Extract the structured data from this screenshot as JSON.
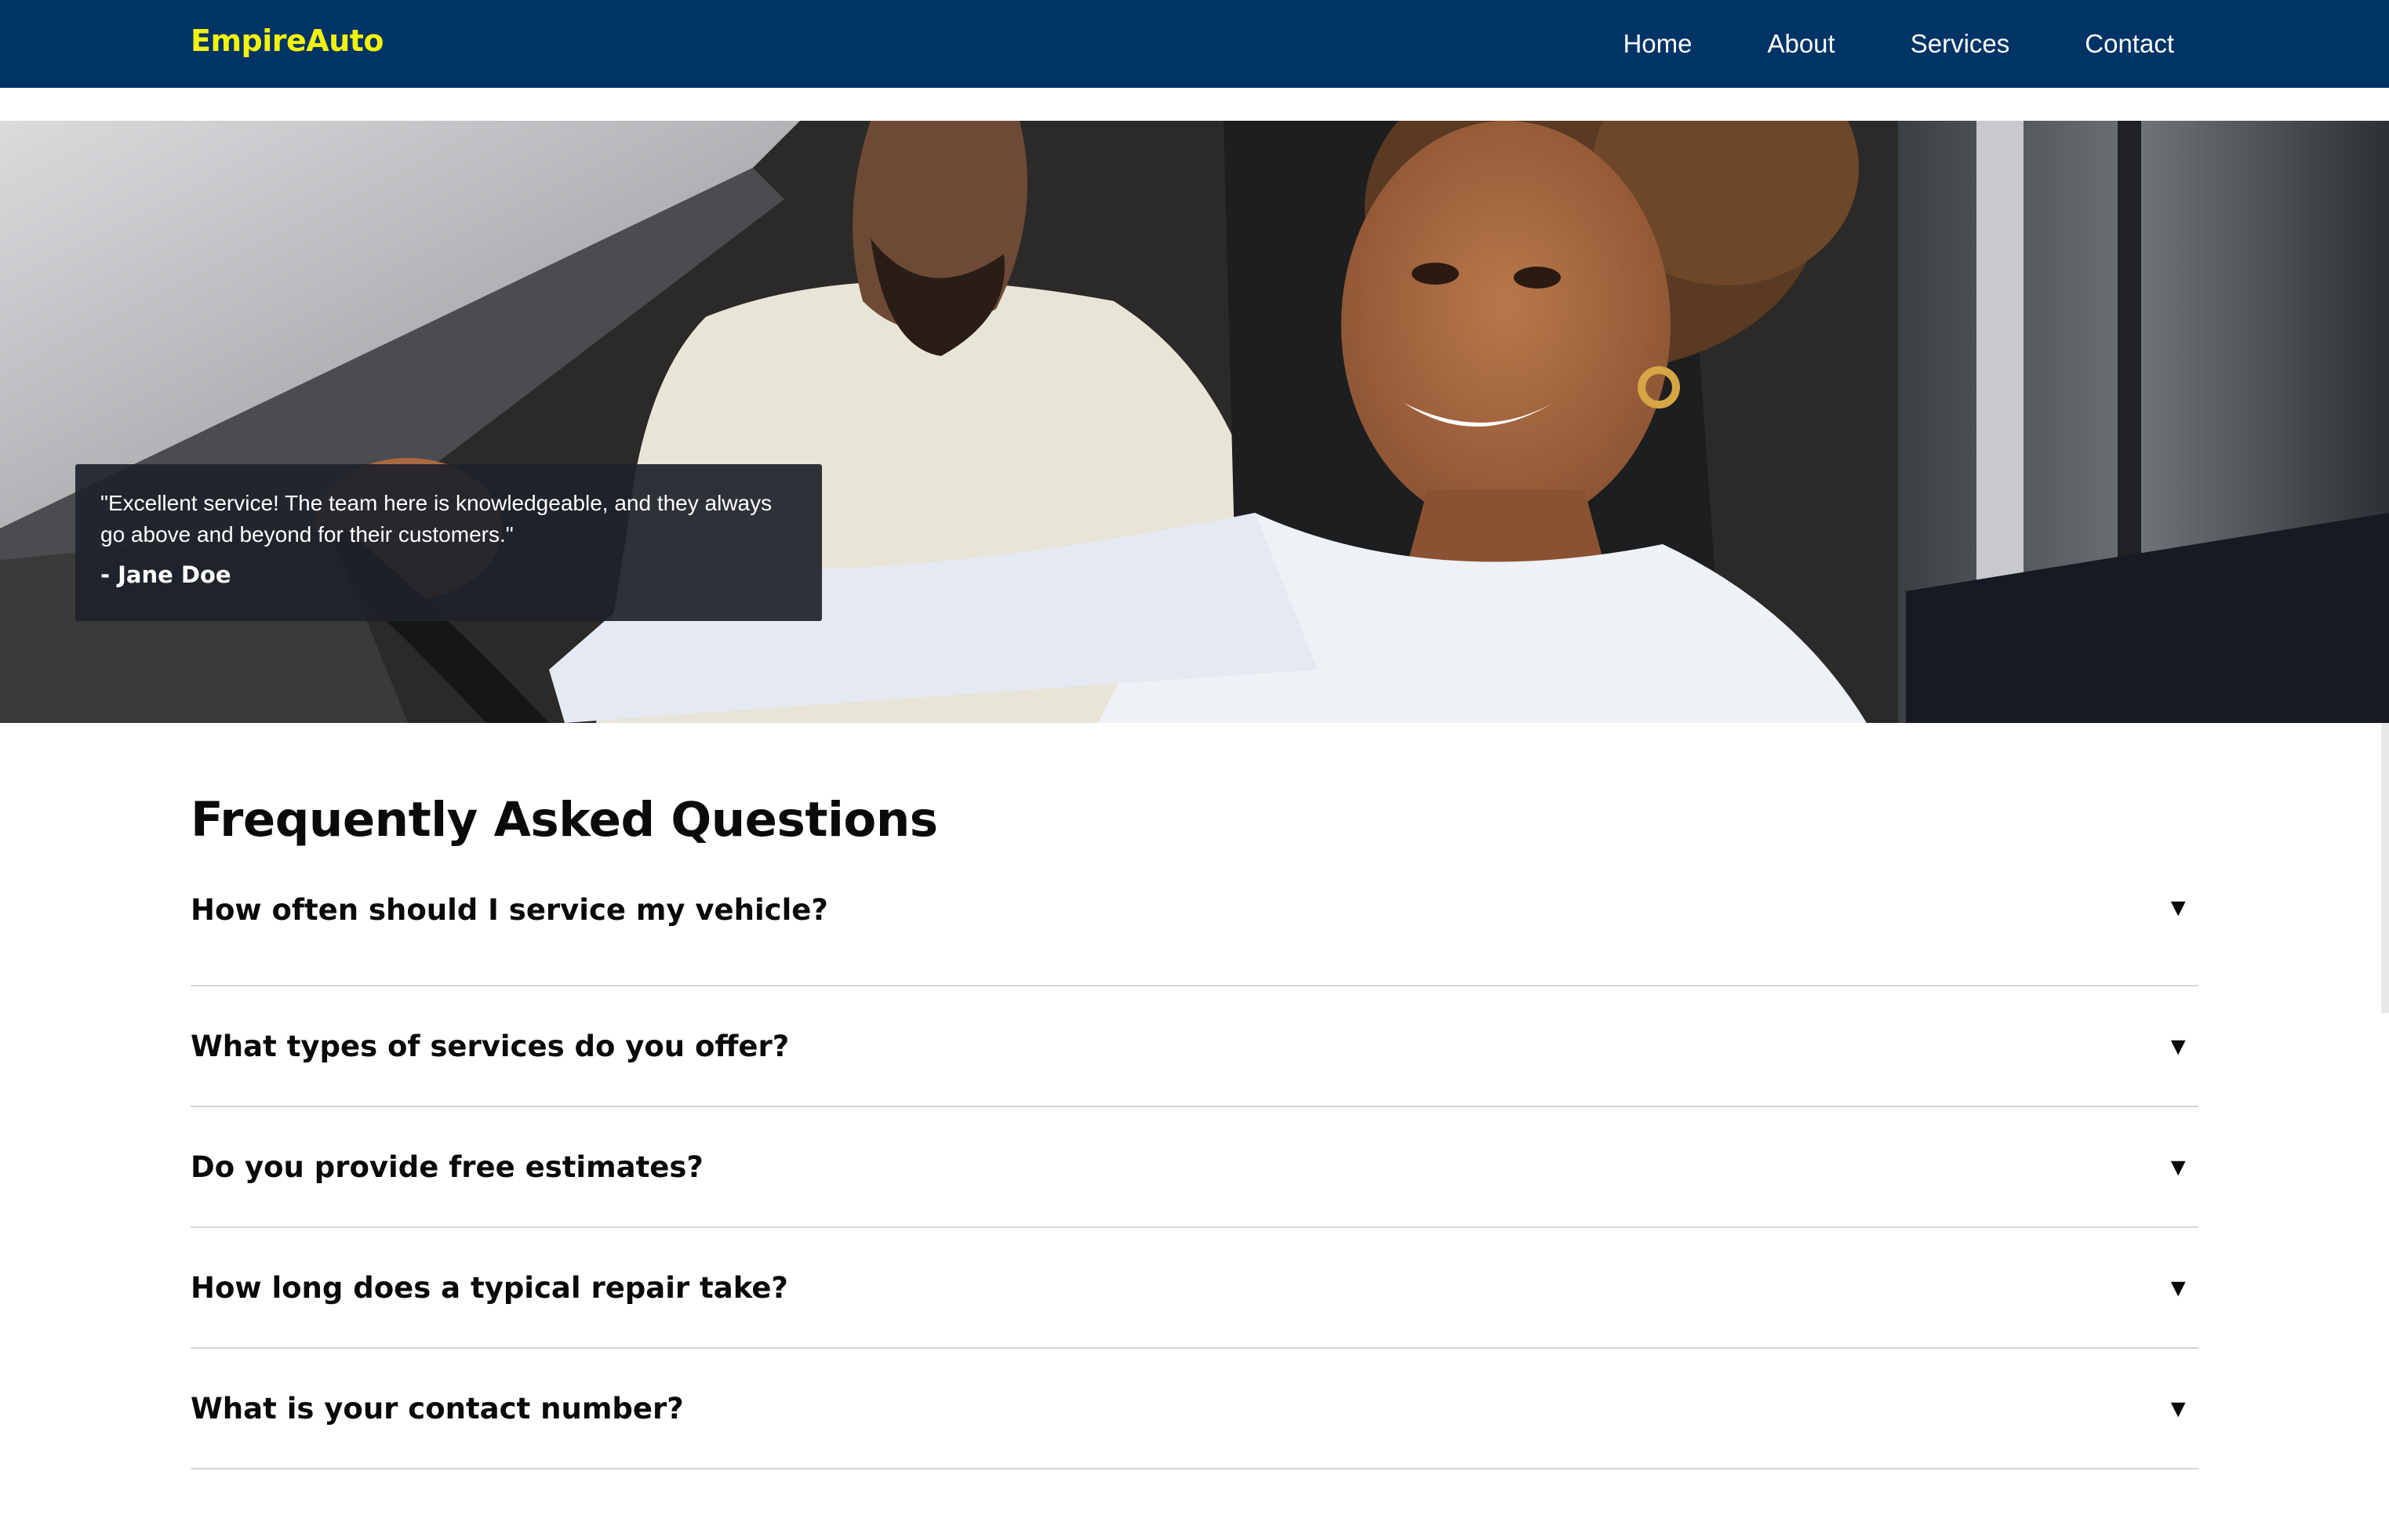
{
  "header": {
    "brand": "EmpireAuto",
    "nav": [
      "Home",
      "About",
      "Services",
      "Contact"
    ]
  },
  "hero": {
    "testimonial": {
      "quote": "\"Excellent service! The team here is knowledgeable, and they always go above and beyond for their customers.\"",
      "author": "- Jane Doe"
    }
  },
  "faq": {
    "title": "Frequently Asked Questions",
    "items": [
      "How often should I service my vehicle?",
      "What types of services do you offer?",
      "Do you provide free estimates?",
      "How long does a typical repair take?",
      "What is your contact number?"
    ],
    "arrow_icon": "triangle-down-icon"
  },
  "colors": {
    "navbar": "#003366",
    "brand": "#f2f20a",
    "testimonial_bg": "#1e222a"
  }
}
